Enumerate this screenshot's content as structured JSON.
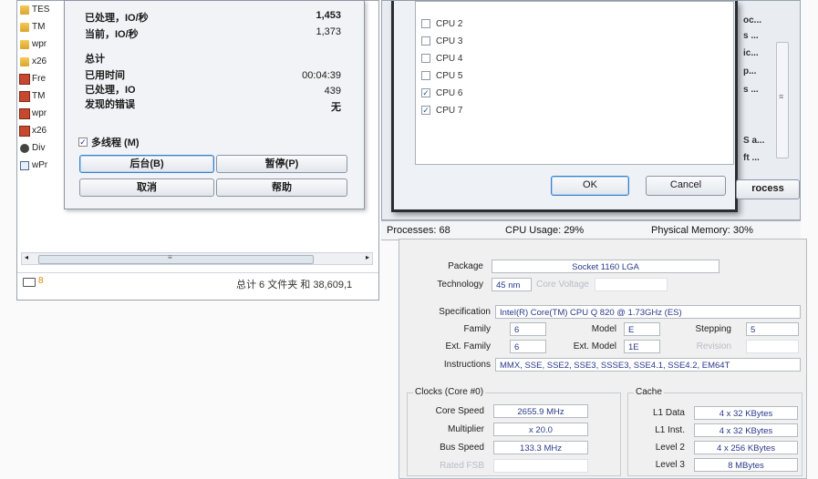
{
  "explorer": {
    "files": [
      {
        "name": "TES",
        "icon": "folder-icon"
      },
      {
        "name": "TM",
        "icon": "folder-icon"
      },
      {
        "name": "wpr",
        "icon": "folder-icon"
      },
      {
        "name": "x26",
        "icon": "folder-icon"
      },
      {
        "name": "Fre",
        "icon": "film-icon"
      },
      {
        "name": "TM",
        "icon": "film-icon"
      },
      {
        "name": "wpr",
        "icon": "film-icon"
      },
      {
        "name": "x26",
        "icon": "film-icon"
      },
      {
        "name": "Div",
        "icon": "drive-icon"
      },
      {
        "name": "wPr",
        "icon": "document-icon"
      }
    ],
    "status_count": "8",
    "status_text": "总计 6 文件夹 和 38,609,1"
  },
  "progress_dialog": {
    "processed_rate_label": "已处理，IO/秒",
    "processed_rate_value": "1,453",
    "current_rate_label": "当前，IO/秒",
    "current_rate_value": "1,373",
    "totals_heading": "总计",
    "elapsed_label": "已用时间",
    "elapsed_value": "00:04:39",
    "processed_label": "已处理，IO",
    "processed_value": "439",
    "errors_label": "发现的错误",
    "errors_value": "无",
    "multithread_label": "多线程 (M)",
    "multithread_checked": true,
    "background_button": "后台(B)",
    "pause_button": "暂停(P)",
    "cancel_button": "取消",
    "help_button": "帮助"
  },
  "affinity_dialog": {
    "cpus": [
      {
        "label": "CPU 2",
        "checked": false
      },
      {
        "label": "CPU 3",
        "checked": false
      },
      {
        "label": "CPU 4",
        "checked": false
      },
      {
        "label": "CPU 5",
        "checked": false
      },
      {
        "label": "CPU 6",
        "checked": true
      },
      {
        "label": "CPU 7",
        "checked": true
      }
    ],
    "ok_button": "OK",
    "cancel_button": "Cancel",
    "side_texts": [
      "oc...",
      "s ...",
      "ic...",
      "p...",
      "s ...",
      "S a...",
      "ft ..."
    ],
    "end_process_button": "rocess"
  },
  "taskmgr_status": {
    "processes": "Processes: 68",
    "cpu_usage": "CPU Usage: 29%",
    "physical_memory": "Physical Memory: 30%"
  },
  "cpuz": {
    "package_label": "Package",
    "package_value": "Socket 1160 LGA",
    "technology_label": "Technology",
    "technology_value": "45 nm",
    "core_voltage_label": "Core Voltage",
    "specification_label": "Specification",
    "specification_value": "Intel(R) Core(TM) CPU      Q 820  @ 1.73GHz (ES)",
    "family_label": "Family",
    "family_value": "6",
    "model_label": "Model",
    "model_value": "E",
    "stepping_label": "Stepping",
    "stepping_value": "5",
    "ext_family_label": "Ext. Family",
    "ext_family_value": "6",
    "ext_model_label": "Ext. Model",
    "ext_model_value": "1E",
    "revision_label": "Revision",
    "instructions_label": "Instructions",
    "instructions_value": "MMX, SSE, SSE2, SSE3, SSSE3, SSE4.1, SSE4.2, EM64T",
    "clocks_title": "Clocks (Core #0)",
    "core_speed_label": "Core Speed",
    "core_speed_value": "2655.9 MHz",
    "multiplier_label": "Multiplier",
    "multiplier_value": "x 20.0",
    "bus_speed_label": "Bus Speed",
    "bus_speed_value": "133.3 MHz",
    "rated_fsb_label": "Rated FSB",
    "cache_title": "Cache",
    "l1_data_label": "L1 Data",
    "l1_data_value": "4 x 32 KBytes",
    "l1_inst_label": "L1 Inst.",
    "l1_inst_value": "4 x 32 KBytes",
    "level2_label": "Level 2",
    "level2_value": "4 x 256 KBytes",
    "level3_label": "Level 3",
    "level3_value": "8 MBytes"
  }
}
